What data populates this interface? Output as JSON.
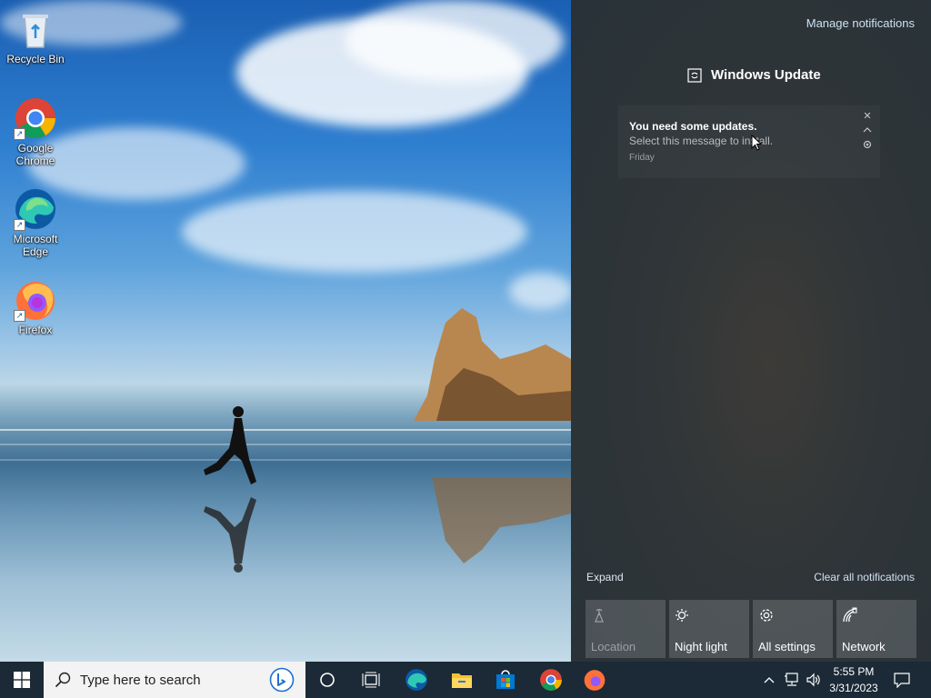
{
  "desktop": {
    "icons": [
      {
        "label": "Recycle Bin"
      },
      {
        "label": "Google Chrome"
      },
      {
        "label": "Microsoft Edge"
      },
      {
        "label": "Firefox"
      }
    ]
  },
  "action_center": {
    "manage_notifications": "Manage notifications",
    "group_title": "Windows Update",
    "notification": {
      "title": "You need some updates.",
      "body": "Select this message to install.",
      "time": "Friday"
    },
    "expand_label": "Expand",
    "clear_all_label": "Clear all notifications",
    "quick_actions": [
      {
        "label": "Location",
        "icon": "location-icon",
        "enabled": false
      },
      {
        "label": "Night light",
        "icon": "night-light-icon",
        "enabled": true
      },
      {
        "label": "All settings",
        "icon": "gear-icon",
        "enabled": true
      },
      {
        "label": "Network",
        "icon": "network-icon",
        "enabled": true
      }
    ]
  },
  "taskbar": {
    "search_placeholder": "Type here to search",
    "time": "5:55 PM",
    "date": "3/31/2023",
    "pinned": [
      "task-view",
      "edge",
      "file-explorer",
      "microsoft-store",
      "chrome",
      "firefox"
    ]
  },
  "colors": {
    "taskbar": "#1b2a36",
    "action_center_bg": "#2f3538",
    "accent": "#0078d4"
  }
}
